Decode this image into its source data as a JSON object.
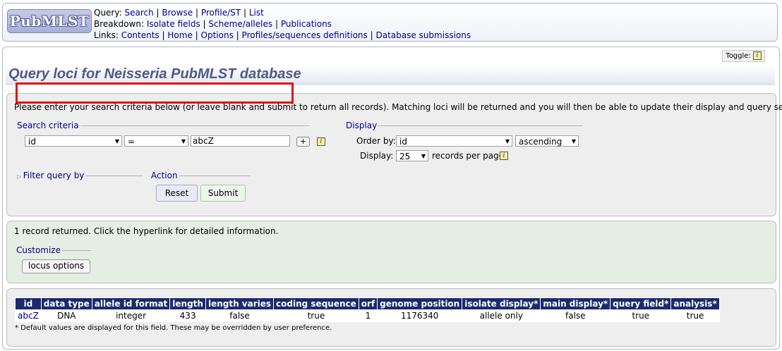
{
  "header": {
    "logo": "PubMLST",
    "query_label": "Query:",
    "query_links": [
      "Search",
      "Browse",
      "Profile/ST",
      "List"
    ],
    "breakdown_label": "Breakdown:",
    "breakdown_links": [
      "Isolate fields",
      "Scheme/alleles",
      "Publications"
    ],
    "links_label": "Links:",
    "links_links": [
      "Contents",
      "Home",
      "Options",
      "Profiles/sequences definitions",
      "Database submissions"
    ],
    "separator": "|"
  },
  "toggle_label": "Toggle:",
  "info_glyph": "i",
  "page_title": "Query loci for Neisseria PubMLST database",
  "search": {
    "instructions": "Please enter your search criteria below (or leave blank and submit to return all records). Matching loci will be returned and you will then be able to update their display and query settings.",
    "criteria_legend": "Search criteria",
    "field_value": "id",
    "operator_value": "=",
    "term_value": "abcZ",
    "add_label": "+",
    "display_legend": "Display",
    "order_by_label": "Order by:",
    "order_by_value": "id",
    "direction_value": "ascending",
    "display_label": "Display:",
    "per_page_value": "25",
    "per_page_suffix": "records per page",
    "filter_legend": "Filter query by",
    "action_legend": "Action",
    "reset_label": "Reset",
    "submit_label": "Submit"
  },
  "results": {
    "summary": "1 record returned. Click the hyperlink for detailed information.",
    "customize_legend": "Customize",
    "locus_options_label": "locus options"
  },
  "table": {
    "headers": [
      "id",
      "data type",
      "allele id format",
      "length",
      "length varies",
      "coding sequence",
      "orf",
      "genome position",
      "isolate display*",
      "main display*",
      "query field*",
      "analysis*"
    ],
    "row": [
      "abcZ",
      "DNA",
      "integer",
      "433",
      "false",
      "true",
      "1",
      "1176340",
      "allele only",
      "false",
      "true",
      "true"
    ],
    "footnote": "* Default values are displayed for this field. These may be overridden by user preference."
  },
  "colors": {
    "link": "#00008b",
    "table_header_bg": "#1c2a6e",
    "title": "#4e5a84",
    "highlight": "#e01010",
    "results_bg": "#e5eee3",
    "search_bg": "#eeeeee"
  }
}
